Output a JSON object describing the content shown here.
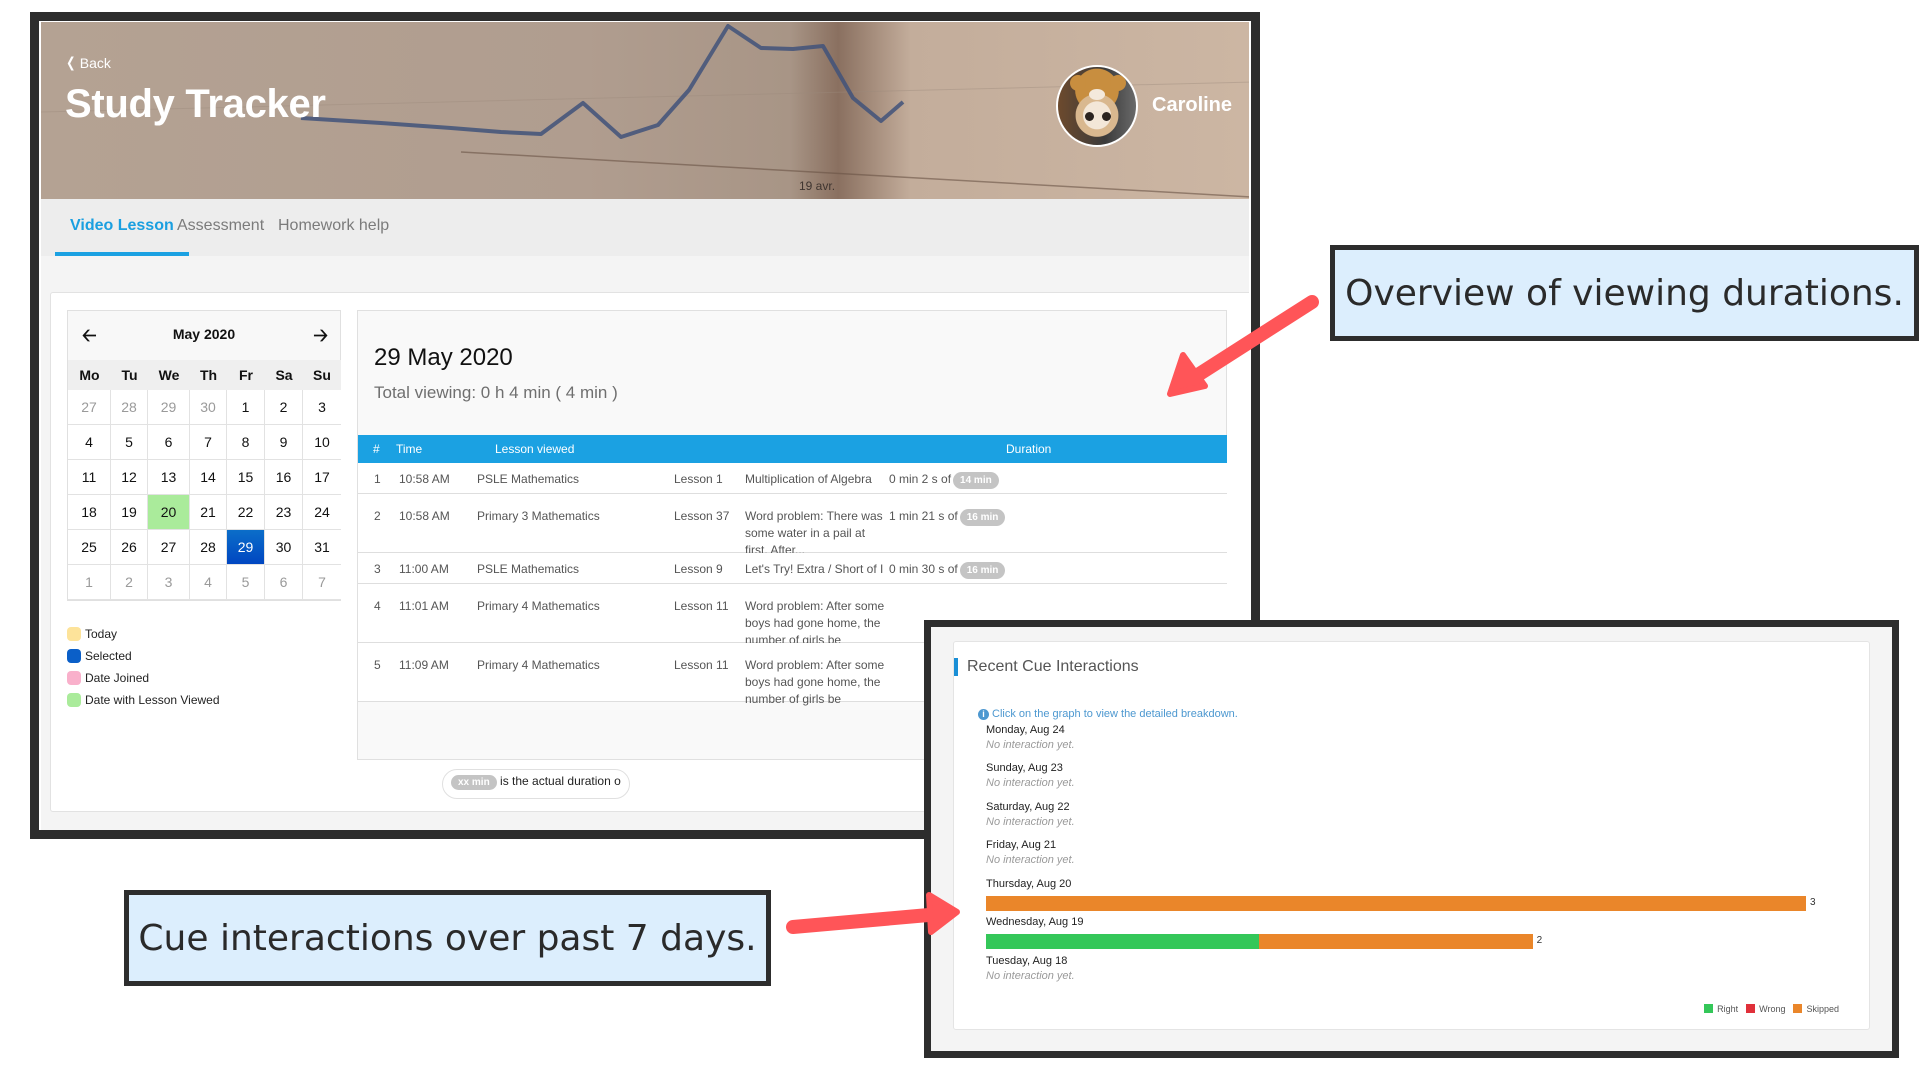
{
  "header": {
    "back_label": "Back",
    "title": "Study Tracker",
    "user_name": "Caroline",
    "avatar_icon": "cat-avatar",
    "banner_caption": "19 avr."
  },
  "tabs": [
    {
      "label": "Video Lesson",
      "active": true
    },
    {
      "label": "Assessment",
      "active": false
    },
    {
      "label": "Homework help",
      "active": false
    }
  ],
  "calendar": {
    "month_label": "May 2020",
    "prev_icon": "arrow-left-icon",
    "next_icon": "arrow-right-icon",
    "weekdays": [
      "Mo",
      "Tu",
      "We",
      "Th",
      "Fr",
      "Sa",
      "Su"
    ],
    "days": [
      {
        "d": "27",
        "muted": true
      },
      {
        "d": "28",
        "muted": true
      },
      {
        "d": "29",
        "muted": true
      },
      {
        "d": "30",
        "muted": true
      },
      {
        "d": "1"
      },
      {
        "d": "2"
      },
      {
        "d": "3"
      },
      {
        "d": "4"
      },
      {
        "d": "5"
      },
      {
        "d": "6"
      },
      {
        "d": "7"
      },
      {
        "d": "8"
      },
      {
        "d": "9"
      },
      {
        "d": "10"
      },
      {
        "d": "11"
      },
      {
        "d": "12"
      },
      {
        "d": "13"
      },
      {
        "d": "14"
      },
      {
        "d": "15"
      },
      {
        "d": "16"
      },
      {
        "d": "17"
      },
      {
        "d": "18"
      },
      {
        "d": "19"
      },
      {
        "d": "20",
        "state": "lesson"
      },
      {
        "d": "21"
      },
      {
        "d": "22"
      },
      {
        "d": "23"
      },
      {
        "d": "24"
      },
      {
        "d": "25"
      },
      {
        "d": "26"
      },
      {
        "d": "27"
      },
      {
        "d": "28"
      },
      {
        "d": "29",
        "state": "selected"
      },
      {
        "d": "30"
      },
      {
        "d": "31"
      },
      {
        "d": "1",
        "muted": true
      },
      {
        "d": "2",
        "muted": true
      },
      {
        "d": "3",
        "muted": true
      },
      {
        "d": "4",
        "muted": true
      },
      {
        "d": "5",
        "muted": true
      },
      {
        "d": "6",
        "muted": true
      },
      {
        "d": "7",
        "muted": true
      }
    ],
    "legend": [
      {
        "label": "Today",
        "color": "#fde39a"
      },
      {
        "label": "Selected",
        "color": "#0a5fc8"
      },
      {
        "label": "Date Joined",
        "color": "#f9b0cb"
      },
      {
        "label": "Date with Lesson Viewed",
        "color": "#aaeb9b"
      }
    ]
  },
  "detail": {
    "date": "29 May 2020",
    "total_viewing": "Total viewing: 0 h 4 min ( 4 min )",
    "columns": [
      "#",
      "Time",
      "Lesson viewed",
      "Duration"
    ],
    "rows": [
      {
        "num": "1",
        "time": "10:58 AM",
        "course": "PSLE Mathematics",
        "lesson": "Lesson 1",
        "title": "Multiplication of Algebra",
        "watched": "0 min 2 s of",
        "length": "14 min"
      },
      {
        "num": "2",
        "time": "10:58 AM",
        "course": "Primary 3 Mathematics",
        "lesson": "Lesson 37",
        "title": "Word problem: There was some water in a pail at first. After...",
        "watched": "1 min 21 s of",
        "length": "16 min"
      },
      {
        "num": "3",
        "time": "11:00 AM",
        "course": "PSLE Mathematics",
        "lesson": "Lesson 9",
        "title": "Let's Try! Extra / Short of I",
        "watched": "0 min 30 s of",
        "length": "16 min"
      },
      {
        "num": "4",
        "time": "11:01 AM",
        "course": "Primary 4 Mathematics",
        "lesson": "Lesson 11",
        "title": "Word problem: After some boys had gone home, the number of girls be",
        "watched": "",
        "length": ""
      },
      {
        "num": "5",
        "time": "11:09 AM",
        "course": "Primary 4 Mathematics",
        "lesson": "Lesson 11",
        "title": "Word problem: After some boys had gone home, the number of girls be",
        "watched": "",
        "length": ""
      }
    ],
    "footnote_pill": "xx min",
    "footnote_text": "is the actual duration o"
  },
  "cue": {
    "title": "Recent Cue Interactions",
    "hint": "Click on the graph to view the detailed breakdown.",
    "no_interaction_text": "No interaction yet.",
    "colors": {
      "right": "#34c759",
      "wrong": "#e0303a",
      "skipped": "#ea862a"
    }
  },
  "chart_data": {
    "type": "bar",
    "orientation": "horizontal-stacked",
    "title": "Recent Cue Interactions",
    "categories": [
      "Monday, Aug 24",
      "Sunday, Aug 23",
      "Saturday, Aug 22",
      "Friday, Aug 21",
      "Thursday, Aug 20",
      "Wednesday, Aug 19",
      "Tuesday, Aug 18"
    ],
    "series": [
      {
        "name": "Right",
        "values": [
          0,
          0,
          0,
          0,
          0,
          1,
          0
        ]
      },
      {
        "name": "Wrong",
        "values": [
          0,
          0,
          0,
          0,
          0,
          0,
          0
        ]
      },
      {
        "name": "Skipped",
        "values": [
          0,
          0,
          0,
          0,
          3,
          1,
          0
        ]
      }
    ],
    "totals": [
      0,
      0,
      0,
      0,
      3,
      2,
      0
    ],
    "xlim": [
      0,
      3
    ],
    "legend": [
      "Right",
      "Wrong",
      "Skipped"
    ],
    "legend_position": "bottom-right"
  },
  "callouts": {
    "overview": "Overview of viewing durations.",
    "cue": "Cue interactions over past 7 days.",
    "arrow_color": "#ff5558"
  }
}
